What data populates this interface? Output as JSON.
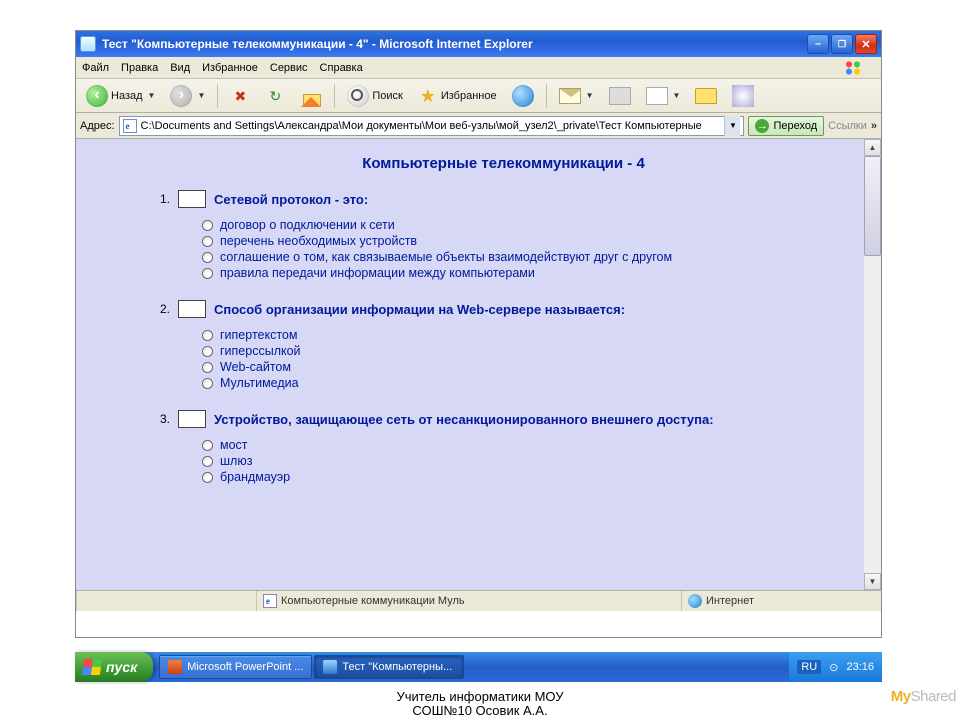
{
  "window": {
    "title": "Тест \"Компьютерные телекоммуникации - 4\" - Microsoft Internet Explorer"
  },
  "menu": {
    "items": [
      "Файл",
      "Правка",
      "Вид",
      "Избранное",
      "Сервис",
      "Справка"
    ]
  },
  "toolbar": {
    "back": "Назад",
    "search": "Поиск",
    "favorites": "Избранное"
  },
  "address": {
    "label": "Адрес:",
    "value": "C:\\Documents and Settings\\Александра\\Мои документы\\Мои веб-узлы\\мой_узел2\\_private\\Тест Компьютерные",
    "go": "Переход",
    "links": "Ссылки"
  },
  "page": {
    "title": "Компьютерные телекоммуникации - 4",
    "questions": [
      {
        "num": "1.",
        "text": "Сетевой протокол - это:",
        "options": [
          "договор о подключении к сети",
          "перечень необходимых устройств",
          "соглашение о том, как связываемые объекты взаимодействуют друг с другом",
          "правила передачи информации между компьютерами"
        ]
      },
      {
        "num": "2.",
        "text": "Способ организации информации на  Web-сервере называется:",
        "options": [
          "гипертекстом",
          "гиперссылкой",
          "Web-сайтом",
          "Мультимедиа"
        ]
      },
      {
        "num": "3.",
        "text": "Устройство, защищающее сеть от несанкционированного внешнего доступа:",
        "options": [
          "мост",
          "шлюз",
          "брандмауэр"
        ]
      }
    ]
  },
  "status": {
    "doc": "Компьютерные коммуникации Муль",
    "zone": "Интернет"
  },
  "taskbar": {
    "start": "пуск",
    "tasks": [
      "Microsoft PowerPoint ...",
      "Тест \"Компьютерны..."
    ],
    "lang": "RU",
    "time": "23:16"
  },
  "caption": {
    "line1": "Учитель информатики МОУ",
    "line2": "СОШ№10 Осовик А.А."
  },
  "watermark": "MyShared"
}
